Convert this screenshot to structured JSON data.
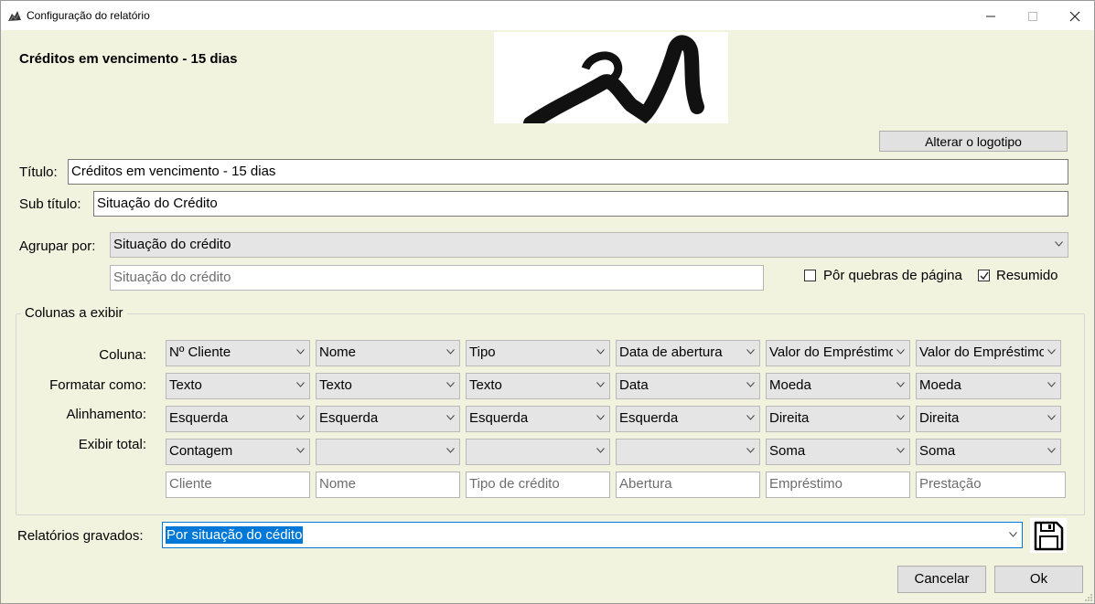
{
  "window": {
    "title": "Configuração do relatório",
    "icon": "app-icon",
    "controls": [
      "minimize-icon",
      "maximize-icon",
      "close-icon"
    ]
  },
  "report_title": "Créditos em vencimento - 15 dias",
  "logo": {
    "change_button": "Alterar o logotipo"
  },
  "fields": {
    "title_label": "Título:",
    "title_value": "Créditos em vencimento - 15 dias",
    "subtitle_label": "Sub título:",
    "subtitle_value": "Situação do Crédito"
  },
  "group_by": {
    "label": "Agrupar por:",
    "selected": "Situação do crédito",
    "caption": "Situação do crédito",
    "page_breaks_label": "Pôr quebras de página",
    "page_breaks_checked": false,
    "summary_label": "Resumido",
    "summary_checked": true
  },
  "columns": {
    "legend": "Colunas a exibir",
    "row_labels": {
      "column": "Coluna:",
      "format": "Formatar como:",
      "alignment": "Alinhamento:",
      "total": "Exibir total:"
    },
    "items": [
      {
        "column": "Nº Cliente",
        "format": "Texto",
        "alignment": "Esquerda",
        "total": "Contagem",
        "caption": "Cliente"
      },
      {
        "column": "Nome",
        "format": "Texto",
        "alignment": "Esquerda",
        "total": "",
        "caption": "Nome"
      },
      {
        "column": "Tipo",
        "format": "Texto",
        "alignment": "Esquerda",
        "total": "",
        "caption": "Tipo de crédito"
      },
      {
        "column": "Data de abertura",
        "format": "Data",
        "alignment": "Esquerda",
        "total": "",
        "caption": "Abertura"
      },
      {
        "column": "Valor do Empréstimo",
        "format": "Moeda",
        "alignment": "Direita",
        "total": "Soma",
        "caption": "Empréstimo"
      },
      {
        "column": "Valor do Empréstimo",
        "format": "Moeda",
        "alignment": "Direita",
        "total": "Soma",
        "caption": "Prestação"
      }
    ]
  },
  "saved_reports": {
    "label": "Relatórios gravados:",
    "selected": "Por situação do cédito",
    "save_icon": "floppy-disk-icon"
  },
  "buttons": {
    "cancel": "Cancelar",
    "ok": "Ok"
  },
  "colors": {
    "background": "#f1f3df",
    "selection": "#0078d7",
    "button": "#e1e1e1"
  }
}
